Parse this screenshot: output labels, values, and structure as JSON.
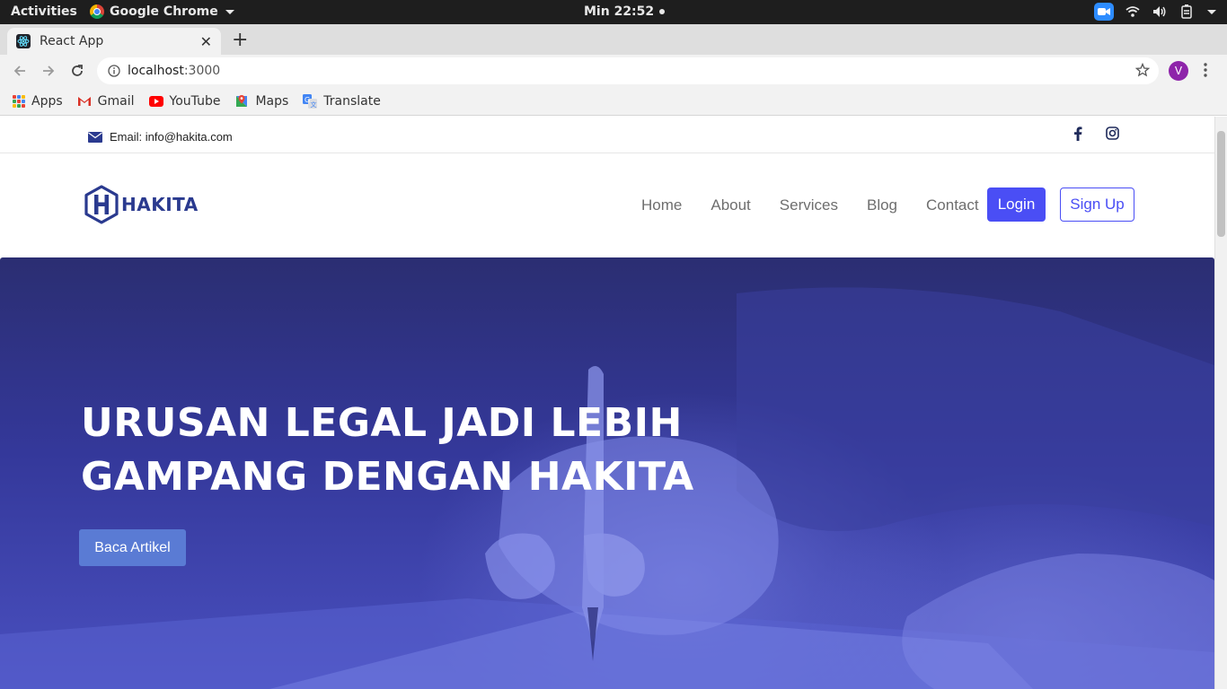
{
  "os_bar": {
    "activities": "Activities",
    "app_name": "Google Chrome",
    "clock": "Min 22:52"
  },
  "browser": {
    "tab_title": "React App",
    "url_host": "localhost",
    "url_port": ":3000",
    "profile_initial": "V",
    "bookmarks": [
      {
        "label": "Apps",
        "icon": "apps-grid-icon"
      },
      {
        "label": "Gmail",
        "icon": "gmail-icon"
      },
      {
        "label": "YouTube",
        "icon": "youtube-icon"
      },
      {
        "label": "Maps",
        "icon": "maps-icon"
      },
      {
        "label": "Translate",
        "icon": "translate-icon"
      }
    ]
  },
  "site": {
    "email_text": "Email: info@hakita.com",
    "brand": "HAKITA",
    "nav": [
      "Home",
      "About",
      "Services",
      "Blog",
      "Contact"
    ],
    "login_label": "Login",
    "signup_label": "Sign Up",
    "hero_title": "URUSAN LEGAL JADI LEBIH GAMPANG DENGAN HAKITA",
    "hero_cta": "Baca Artikel",
    "colors": {
      "brand_primary": "#4a4ef5",
      "brand_dark": "#2a3a8f",
      "hero_cta": "#5a7bd4"
    }
  }
}
